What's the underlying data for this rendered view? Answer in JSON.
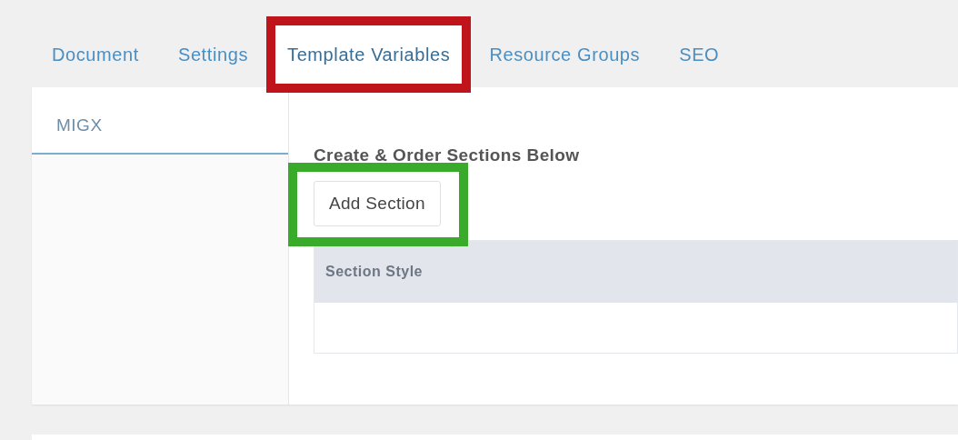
{
  "tabs": [
    {
      "label": "Document",
      "selected": false
    },
    {
      "label": "Settings",
      "selected": false
    },
    {
      "label": "Template Variables",
      "selected": true,
      "color": "#c0141c"
    },
    {
      "label": "Resource Groups",
      "selected": false
    },
    {
      "label": "SEO",
      "selected": false
    }
  ],
  "side_tabs": [
    {
      "label": "MIGX",
      "selected": true
    }
  ],
  "section": {
    "heading": "Create & Order Sections Below",
    "button": {
      "label": "Add Section",
      "color": "#3aaa2a"
    },
    "grid": {
      "columns": [
        "Section Style"
      ]
    }
  }
}
